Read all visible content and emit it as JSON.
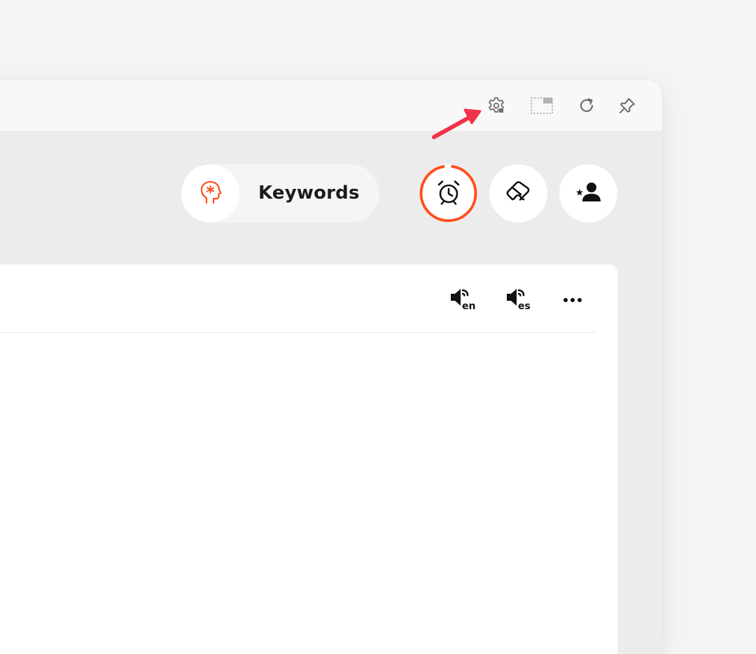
{
  "titlebar": {
    "icons": [
      "settings-icon",
      "picture-in-picture-icon",
      "refresh-icon",
      "pin-icon"
    ]
  },
  "toolbar": {
    "keywords_label": "Keywords",
    "keywords_icon": "brain-head-icon",
    "buttons": [
      "alarm-clock-icon",
      "eraser-icon",
      "favorite-user-icon"
    ]
  },
  "panel": {
    "header": {
      "audio_en_label": "en",
      "audio_es_label": "es",
      "more_icon": "more-icon"
    }
  },
  "colors": {
    "accent": "#ff4f1f",
    "annotation_arrow": "#f2334a",
    "icon_dark": "#111111",
    "icon_grey": "#6e6e6e"
  }
}
